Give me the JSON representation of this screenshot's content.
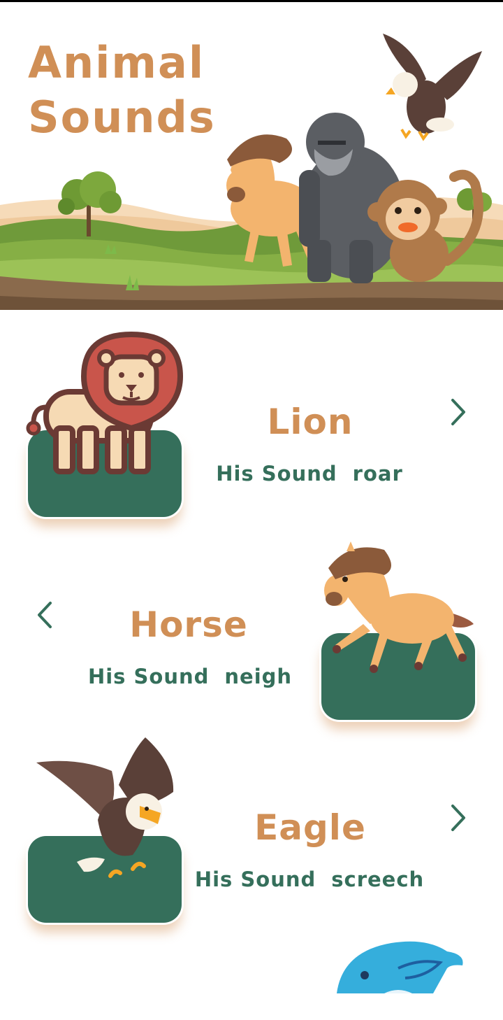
{
  "header": {
    "title_line1": "Animal",
    "title_line2": "Sounds"
  },
  "animals": [
    {
      "name": "Lion",
      "sound_label": "His Sound",
      "sound": "roar",
      "nav_icon": "chevron-right-icon"
    },
    {
      "name": "Horse",
      "sound_label": "His Sound",
      "sound": "neigh",
      "nav_icon": "chevron-left-icon"
    },
    {
      "name": "Eagle",
      "sound_label": "His Sound",
      "sound": "screech",
      "nav_icon": "chevron-right-icon"
    }
  ],
  "colors": {
    "title": "#D08F56",
    "tile": "#356F5B",
    "text_green": "#356F5B",
    "tile_shadow": "#D4965F"
  }
}
